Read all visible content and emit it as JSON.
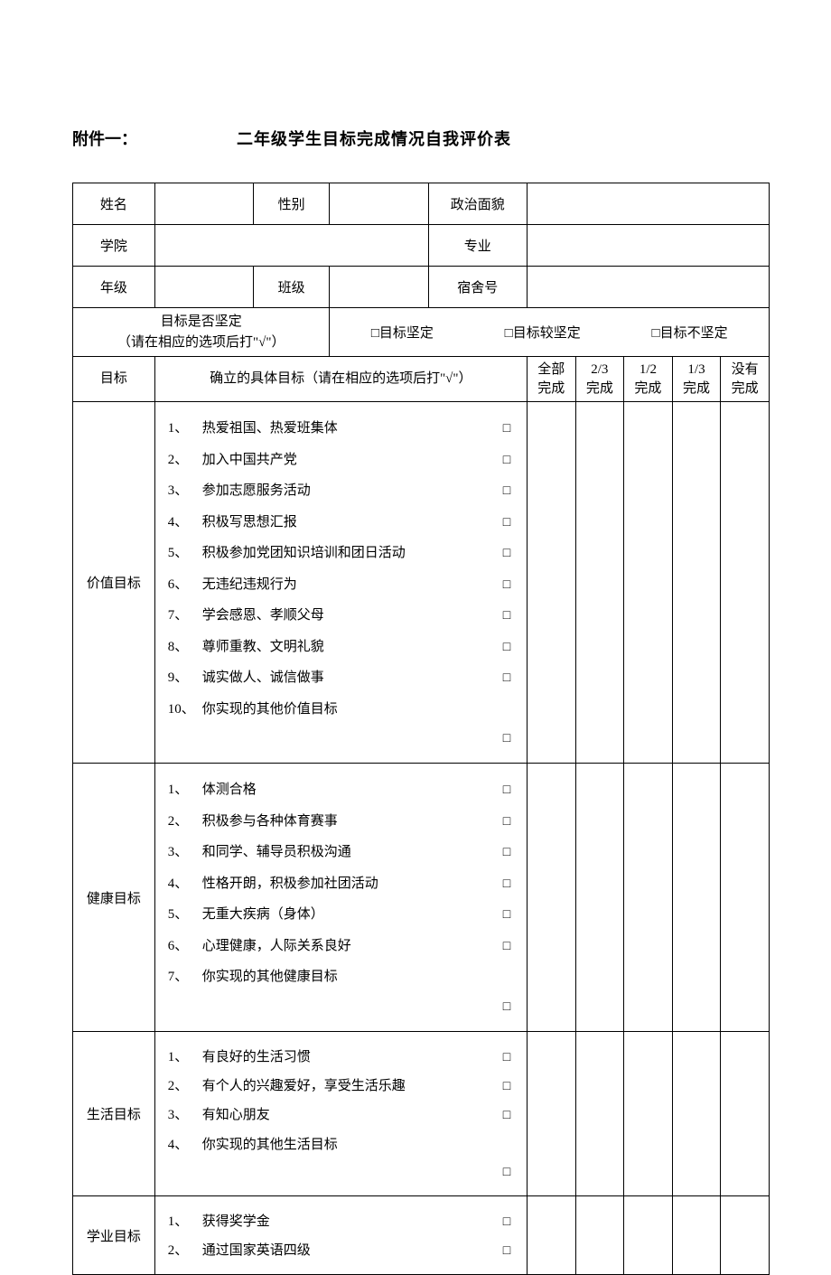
{
  "attachment_label": "附件一：",
  "title": "二年级学生目标完成情况自我评价表",
  "labels": {
    "name": "姓名",
    "gender": "性别",
    "politics": "政治面貌",
    "college": "学院",
    "major": "专业",
    "grade": "年级",
    "class": "班级",
    "dorm": "宿舍号"
  },
  "firmness": {
    "label_line1": "目标是否坚定",
    "label_line2": "（请在相应的选项后打\"√\"）",
    "opt1": "□目标坚定",
    "opt2": "□目标较坚定",
    "opt3": "□目标不坚定"
  },
  "goal_header": {
    "goal": "目标",
    "detail": "确立的具体目标（请在相应的选项后打\"√\"）",
    "c1a": "全部",
    "c1b": "完成",
    "c2a": "2/3",
    "c2b": "完成",
    "c3a": "1/2",
    "c3b": "完成",
    "c4a": "1/3",
    "c4b": "完成",
    "c5a": "没有",
    "c5b": "完成"
  },
  "checkbox": "□",
  "sections": {
    "value": {
      "title": "价值目标",
      "items": [
        {
          "n": "1、",
          "t": "热爱祖国、热爱班集体",
          "b": true
        },
        {
          "n": "2、",
          "t": "加入中国共产党",
          "b": true
        },
        {
          "n": "3、",
          "t": "参加志愿服务活动",
          "b": true
        },
        {
          "n": "4、",
          "t": "积极写思想汇报",
          "b": true
        },
        {
          "n": "5、",
          "t": "积极参加党团知识培训和团日活动",
          "b": true
        },
        {
          "n": "6、",
          "t": "无违纪违规行为",
          "b": true
        },
        {
          "n": "7、",
          "t": "学会感恩、孝顺父母",
          "b": true
        },
        {
          "n": "8、",
          "t": "尊师重教、文明礼貌",
          "b": true
        },
        {
          "n": "9、",
          "t": "诚实做人、诚信做事",
          "b": true
        },
        {
          "n": "10、",
          "t": "你实现的其他价值目标",
          "b": false
        },
        {
          "n": "",
          "t": "",
          "b": true
        }
      ]
    },
    "health": {
      "title": "健康目标",
      "items": [
        {
          "n": "1、",
          "t": "体测合格",
          "b": true
        },
        {
          "n": "2、",
          "t": "积极参与各种体育赛事",
          "b": true
        },
        {
          "n": "3、",
          "t": "和同学、辅导员积极沟通",
          "b": true
        },
        {
          "n": "4、",
          "t": "性格开朗，积极参加社团活动",
          "b": true
        },
        {
          "n": "5、",
          "t": "无重大疾病（身体）",
          "b": true
        },
        {
          "n": "6、",
          "t": "心理健康，人际关系良好",
          "b": true
        },
        {
          "n": "7、",
          "t": "你实现的其他健康目标",
          "b": false
        },
        {
          "n": "",
          "t": "",
          "b": true
        }
      ]
    },
    "life": {
      "title": "生活目标",
      "items": [
        {
          "n": "1、",
          "t": "有良好的生活习惯",
          "b": true,
          "tight": true
        },
        {
          "n": "2、",
          "t": "有个人的兴趣爱好，享受生活乐趣",
          "b": true,
          "tight": true
        },
        {
          "n": "3、",
          "t": "有知心朋友",
          "b": true,
          "tight": true
        },
        {
          "n": "4、",
          "t": "你实现的其他生活目标",
          "b": false,
          "tight": true
        },
        {
          "n": "",
          "t": "",
          "b": true,
          "tight": true
        }
      ]
    },
    "study": {
      "title": "学业目标",
      "items": [
        {
          "n": "1、",
          "t": "获得奖学金",
          "b": true,
          "tight": true
        },
        {
          "n": "2、",
          "t": "通过国家英语四级",
          "b": true,
          "tight": true
        }
      ]
    }
  }
}
